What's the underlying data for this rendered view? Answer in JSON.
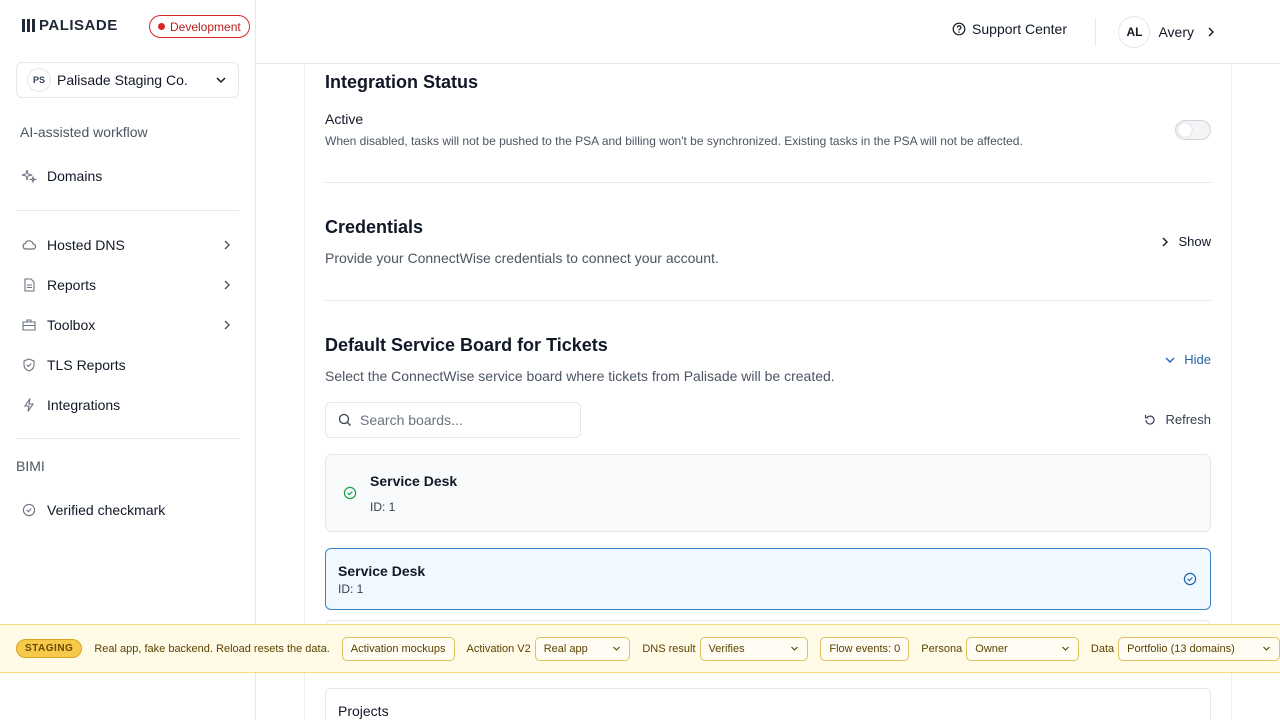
{
  "brand": {
    "name": "PALISADE",
    "env_badge": "Development"
  },
  "org": {
    "initials": "PS",
    "name": "Palisade Staging Co."
  },
  "sidebar": {
    "section_ai": "AI-assisted workflow",
    "items": [
      {
        "label": "Domains",
        "icon": "sparkle-icon"
      },
      {
        "label": "Hosted DNS",
        "icon": "cloud-icon"
      },
      {
        "label": "Reports",
        "icon": "document-icon"
      },
      {
        "label": "Toolbox",
        "icon": "briefcase-icon"
      },
      {
        "label": "TLS Reports",
        "icon": "shield-icon"
      },
      {
        "label": "Integrations",
        "icon": "bolt-icon"
      }
    ],
    "section_bimi": "BIMI",
    "bimi_items": [
      {
        "label": "Verified checkmark",
        "icon": "check-circle-icon"
      }
    ]
  },
  "header": {
    "support": "Support Center",
    "user_initials": "AL",
    "user_name": "Avery"
  },
  "integration": {
    "title": "Integration Status",
    "active_label": "Active",
    "active_desc": "When disabled, tasks will not be pushed to the PSA and billing won't be synchronized. Existing tasks in the PSA will not be affected.",
    "active_on": false
  },
  "credentials": {
    "title": "Credentials",
    "desc": "Provide your ConnectWise credentials to connect your account.",
    "toggle_label": "Show"
  },
  "service_board": {
    "title": "Default Service Board for Tickets",
    "desc": "Select the ConnectWise service board where tickets from Palisade will be created.",
    "toggle_label": "Hide",
    "search_placeholder": "Search boards...",
    "refresh_label": "Refresh",
    "boards": [
      {
        "name": "Service Desk",
        "id": "ID: 1"
      },
      {
        "name": "Service Desk",
        "id": "ID: 1"
      },
      {
        "name": "Projects"
      }
    ]
  },
  "staging": {
    "pill": "STAGING",
    "text": "Real app, fake backend. Reload resets the data.",
    "activation_mockups": "Activation mockups",
    "activation_v2_label": "Activation V2",
    "activation_v2_value": "Real app",
    "dns_result_label": "DNS result",
    "dns_result_value": "Verifies",
    "flow_events": "Flow events: 0",
    "persona_label": "Persona",
    "persona_value": "Owner",
    "data_label": "Data",
    "data_value": "Portfolio (13 domains)"
  },
  "colors": {
    "accent": "#3b82c4",
    "success": "#16a34a",
    "danger": "#dc2626",
    "staging": "#f6c94a"
  }
}
